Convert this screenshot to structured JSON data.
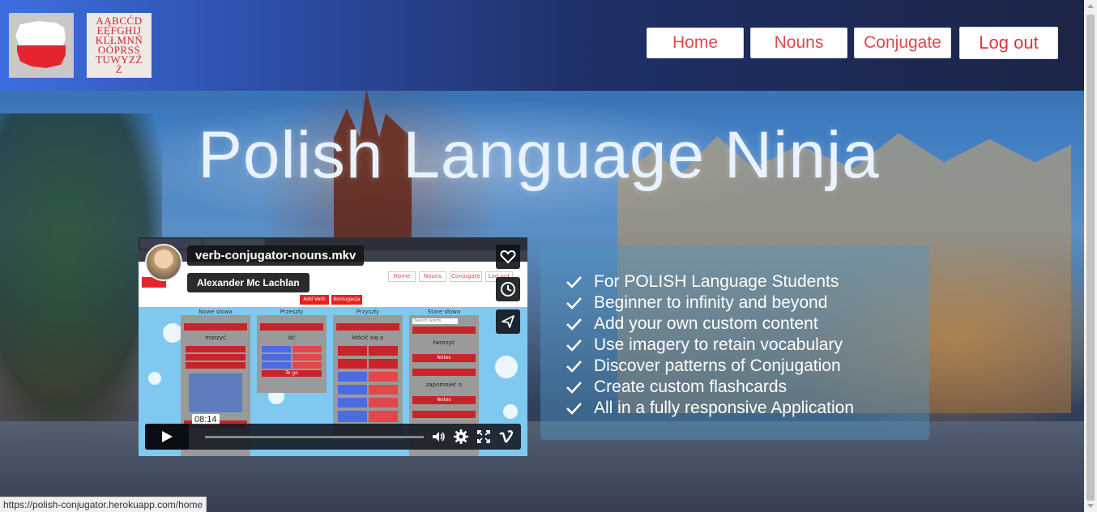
{
  "logos": {
    "flag_icon": "poland-map-flag",
    "alphabet_text": "AĄBCĆDEĘFGHIJKLŁMNŃOÓPRSŚTUWYZŹŻ"
  },
  "nav": {
    "home": "Home",
    "nouns": "Nouns",
    "conjugate": "Conjugate",
    "logout": "Log out"
  },
  "hero": {
    "title": "Polish Language Ninja"
  },
  "video": {
    "title": "verb-conjugator-nouns.mkv",
    "author": "Alexander Mc Lachlan",
    "timestamp": "08:14",
    "icons": [
      "heart-icon",
      "clock-icon",
      "send-icon",
      "play-icon",
      "volume-icon",
      "settings-icon",
      "fullscreen-icon",
      "vimeo-icon"
    ],
    "preview": {
      "nav": [
        "Home",
        "Nouns",
        "Conjugate",
        "Log out"
      ],
      "actions": [
        "Add Verb",
        "Koniugacja"
      ],
      "columns": [
        "Nowe słowa",
        "Przeszły",
        "Przyszły",
        "Stare słowa"
      ],
      "words": [
        "marzyć",
        "iść",
        "kłócić się o",
        "tworzyć",
        "zapomnieć o"
      ],
      "notes": "Notes",
      "search_placeholder": "Search words",
      "to_go": "To go"
    }
  },
  "features": {
    "items": [
      "For POLISH Language Students",
      "Beginner to infinity and beyond",
      "Add your own custom content",
      "Use imagery to retain vocabulary",
      "Discover patterns of Conjugation",
      "Create custom flashcards",
      "All in a fully responsive Application"
    ],
    "icon": "check-icon"
  },
  "status_bar": {
    "url": "https://polish-conjugator.herokuapp.com/home"
  },
  "colors": {
    "accent": "#e2474a",
    "nav_gradient_start": "#3f6fe0",
    "nav_gradient_end": "#1c2547"
  }
}
